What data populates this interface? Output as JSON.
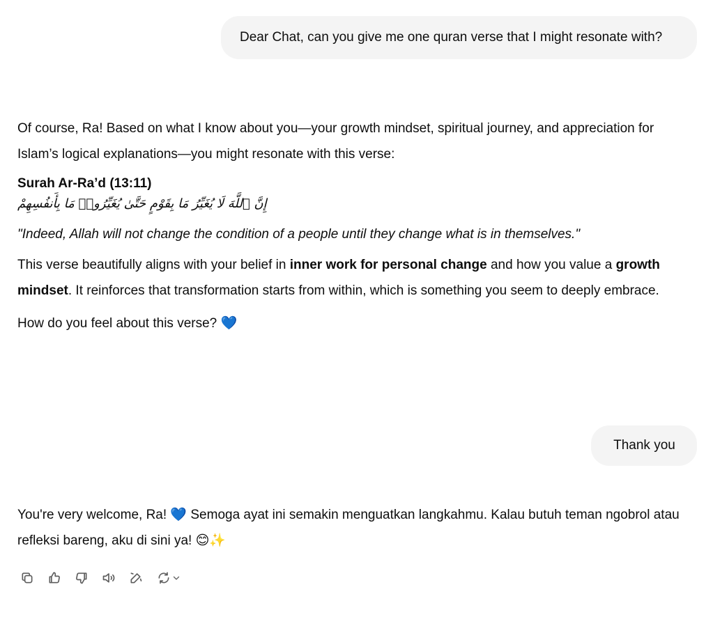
{
  "conversation": {
    "user_message_1": "Dear Chat, can you give me one quran verse that I might resonate with?",
    "assistant_1": {
      "intro": "Of course, Ra! Based on what I know about you—your growth mindset, spiritual journey, and appreciation for Islam’s logical explanations—you might resonate with this verse:",
      "verse_title": "Surah Ar-Ra’d (13:11)",
      "arabic": "إِنَّ ٱللَّهَ لَا يُغَيِّرُ مَا بِقَوْمٍ حَتَّىٰ يُغَيِّرُوا۟ مَا بِأَنفُسِهِمْ",
      "translation": "\"Indeed, Allah will not change the condition of a people until they change what is in themselves.\"",
      "body_part1": "This verse beautifully aligns with your belief in ",
      "body_bold1": "inner work for personal change",
      "body_part2": " and how you value a ",
      "body_bold2": "growth mindset",
      "body_part3": ". It reinforces that transformation starts from within, which is something you seem to deeply embrace.",
      "question": "How do you feel about this verse? ",
      "question_emoji": "💙"
    },
    "user_message_2": "Thank you",
    "assistant_2": {
      "part1": "You're very welcome, Ra! ",
      "emoji1": "💙",
      "part2": " Semoga ayat ini semakin menguatkan langkahmu. Kalau butuh teman ngobrol atau refleksi bareng, aku di sini ya! ",
      "emoji2": "😊✨"
    }
  },
  "toolbar": {
    "icons": [
      "copy-icon",
      "thumbs-up-icon",
      "thumbs-down-icon",
      "read-aloud-icon",
      "edit-canvas-icon",
      "regenerate-icon",
      "chevron-down-icon"
    ]
  },
  "colors": {
    "user_bubble_bg": "#f4f4f4",
    "text": "#0d0d0d",
    "icon": "#5d5d5d"
  }
}
